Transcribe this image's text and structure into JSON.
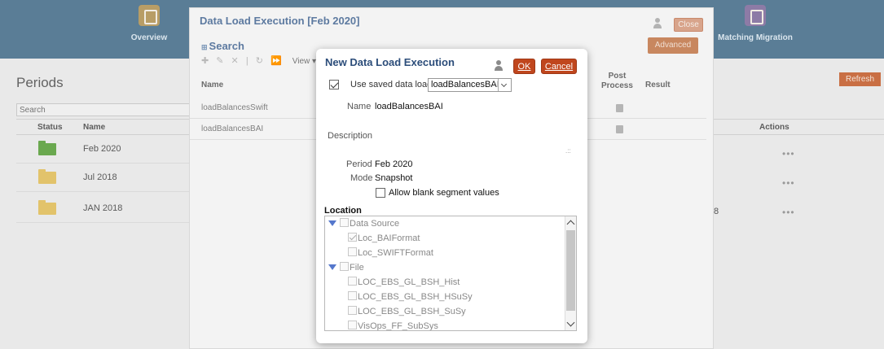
{
  "top_nav": {
    "overview_label": "Overview",
    "matching_label": "Matching Migration",
    "overview_icon": "document-edit-icon",
    "matching_icon": "document-check-icon"
  },
  "periods": {
    "title": "Periods",
    "search_placeholder": "Search",
    "columns": {
      "status": "Status",
      "name": "Name"
    },
    "rows": [
      {
        "name": "Feb 2020",
        "status_color": "#6aa84f"
      },
      {
        "name": "Jul 2018",
        "status_color": "#e2c36b"
      },
      {
        "name": "JAN 2018",
        "status_color": "#e2c36b"
      }
    ]
  },
  "right_panel": {
    "refresh_label": "Refresh",
    "actions_header": "Actions",
    "row_actions": [
      "•••",
      "•••",
      "•••"
    ],
    "row3_trailing_text": "8"
  },
  "mid_dialog": {
    "title": "Data Load Execution [Feb 2020]",
    "search_title": "Search",
    "search_expander": "⊞",
    "toolbar_icons": "✚ ✎ ✕ | ↻ ⏩",
    "view_menu": "View ▾",
    "close_label": "Close",
    "advanced_label": "Advanced",
    "columns": {
      "name": "Name",
      "post_process_line1": "Post",
      "post_process_line2": "Process",
      "result": "Result"
    },
    "rows": [
      {
        "name": "loadBalancesSwift"
      },
      {
        "name": "loadBalancesBAI"
      }
    ]
  },
  "front_dialog": {
    "title": "New Data Load Execution",
    "ok_label": "OK",
    "cancel_label": "Cancel",
    "use_saved_label": "Use saved data load",
    "use_saved_checked": true,
    "saved_load_value": "loadBalancesBAI",
    "name_label": "Name",
    "name_value": "loadBalancesBAI",
    "description_label": "Description",
    "period_label": "Period",
    "period_value": "Feb 2020",
    "mode_label": "Mode",
    "mode_value": "Snapshot",
    "allow_blank_label": "Allow blank segment values",
    "allow_blank_checked": false,
    "location_title": "Location",
    "tree": [
      {
        "label": "Data Source",
        "level": 0,
        "expandable": true,
        "checked": false
      },
      {
        "label": "Loc_BAIFormat",
        "level": 1,
        "expandable": false,
        "checked": true
      },
      {
        "label": "Loc_SWIFTFormat",
        "level": 1,
        "expandable": false,
        "checked": false
      },
      {
        "label": "File",
        "level": 0,
        "expandable": true,
        "checked": false
      },
      {
        "label": "LOC_EBS_GL_BSH_Hist",
        "level": 1,
        "expandable": false,
        "checked": false
      },
      {
        "label": "LOC_EBS_GL_BSH_HSuSy",
        "level": 1,
        "expandable": false,
        "checked": false
      },
      {
        "label": "LOC_EBS_GL_BSH_SuSy",
        "level": 1,
        "expandable": false,
        "checked": false
      },
      {
        "label": "VisOps_FF_SubSys",
        "level": 1,
        "expandable": false,
        "checked": false
      }
    ]
  }
}
